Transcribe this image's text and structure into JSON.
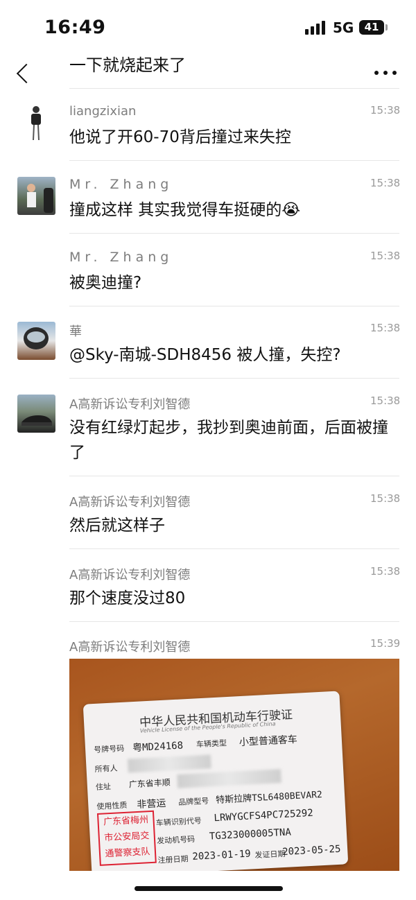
{
  "status_bar": {
    "time": "16:49",
    "network": "5G",
    "battery": "41"
  },
  "header": {
    "title": "一下就烧起来了",
    "back_icon": "chevron-left-icon",
    "more_icon": "ellipsis-icon"
  },
  "messages": [
    {
      "sender": "liangzixian",
      "time": "15:38",
      "text": "他说了开60-70背后撞过来失控"
    },
    {
      "sender": "Mr. Zhang",
      "time": "15:38",
      "text": "撞成这样  其实我觉得车挺硬的😭"
    },
    {
      "sender": "Mr. Zhang",
      "time": "15:38",
      "text": "被奥迪撞?"
    },
    {
      "sender": "華",
      "time": "15:38",
      "text": "@Sky-南城-SDH8456 被人撞，失控?"
    },
    {
      "sender": "A高新诉讼专利刘智德",
      "time": "15:38",
      "text": "没有红绿灯起步，我抄到奥迪前面，后面被撞了"
    },
    {
      "sender": "A高新诉讼专利刘智德",
      "time": "15:38",
      "text": "然后就这样子"
    },
    {
      "sender": "A高新诉讼专利刘智德",
      "time": "15:38",
      "text": "那个速度没过80"
    },
    {
      "sender": "A高新诉讼专利刘智德",
      "time": "15:39",
      "text": ""
    }
  ],
  "license_card": {
    "title": "中华人民共和国机动车行驶证",
    "subtitle": "Vehicle License of the People's Republic of China",
    "plate_label": "号牌号码",
    "plate_value": "粤MD24168",
    "type_label": "车辆类型",
    "type_value": "小型普通客车",
    "owner_label": "所有人",
    "address_label": "住址",
    "address_value": "广东省丰顺",
    "use_label": "使用性质",
    "use_value": "非营运",
    "model_label": "品牌型号",
    "model_value": "特斯拉牌TSL6480BEVAR2",
    "vin_label": "车辆识别代号",
    "vin_value": "LRWYGCFS4PC725292",
    "engine_label": "发动机号码",
    "engine_value": "TG323000005TNA",
    "reg_label": "注册日期",
    "reg_value": "2023-01-19",
    "issue_label": "发证日期",
    "issue_value": "2023-05-25",
    "stamp_lines": [
      "广东省梅州",
      "市公安局交",
      "通警察支队"
    ]
  }
}
